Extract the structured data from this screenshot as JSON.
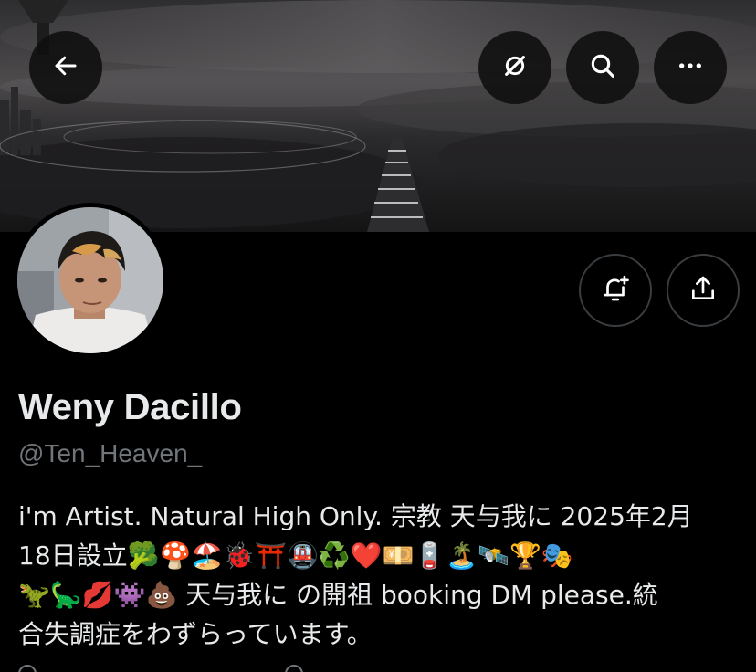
{
  "header": {
    "back_icon": "arrow-left-icon",
    "hide_icon": "eye-slash-icon",
    "search_icon": "search-icon",
    "more_icon": "more-horizontal-icon"
  },
  "actions": {
    "notify_icon": "bell-plus-icon",
    "share_icon": "share-icon"
  },
  "profile": {
    "name": "Weny Dacillo",
    "handle": "@Ten_Heaven_",
    "bio_lines": [
      "i'm Artist. Natural High Only. 宗教 天与我に 2025年2月",
      "18日設立🥦🍄🏖️🐞⛩️🚇♻️❤️💴🪫🏝️🛰️🏆🎭",
      "🦖🦕💋👾💩 天与我に の開祖 booking DM please.統",
      "合失調症をわずらっています。"
    ]
  },
  "colors": {
    "background": "#000000",
    "text_primary": "#e7e9ea",
    "text_secondary": "#71767b",
    "button_border": "#3a3d40"
  }
}
